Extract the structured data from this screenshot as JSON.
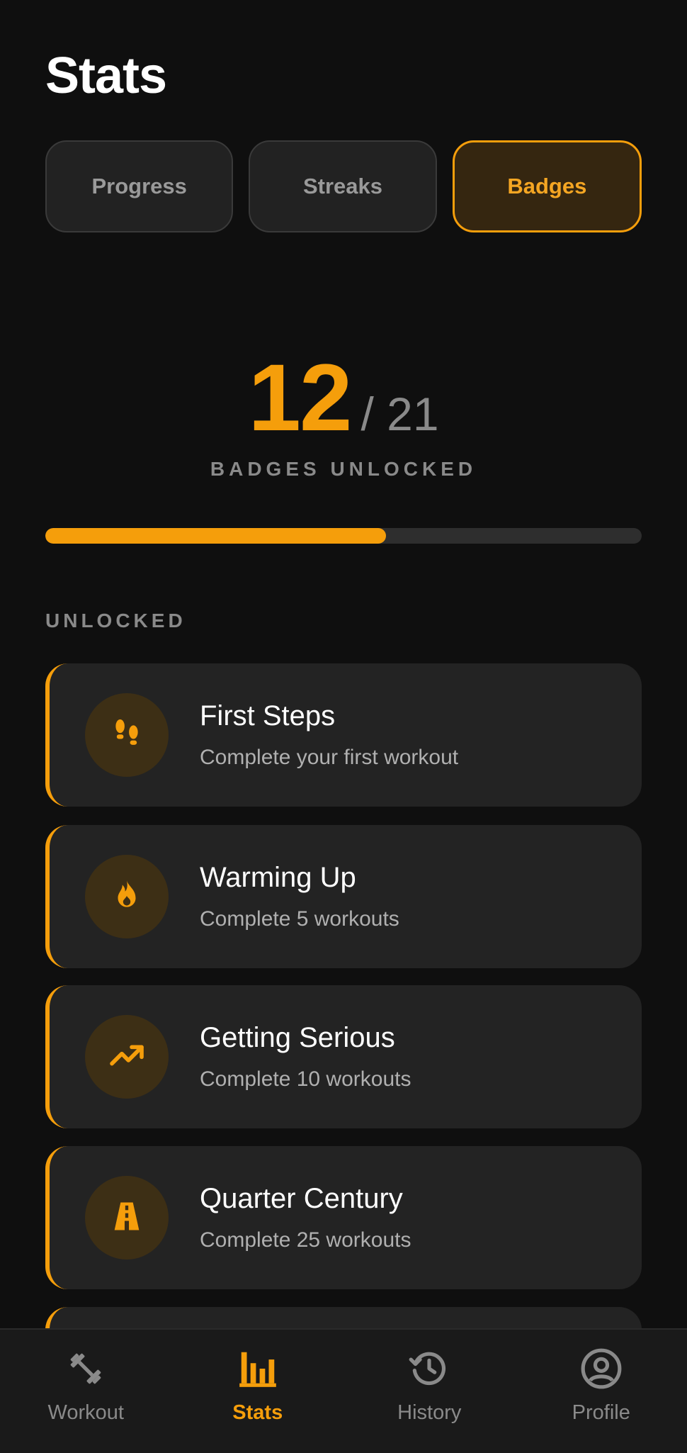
{
  "header": {
    "title": "Stats"
  },
  "tabs": [
    {
      "label": "Progress",
      "active": false
    },
    {
      "label": "Streaks",
      "active": false
    },
    {
      "label": "Badges",
      "active": true
    }
  ],
  "summary": {
    "unlocked": "12",
    "total": "/ 21",
    "caption": "BADGES UNLOCKED",
    "progress_fraction": 0.571
  },
  "section_title": "UNLOCKED",
  "badges": [
    {
      "name": "First Steps",
      "desc": "Complete your first workout",
      "icon": "footprints-icon"
    },
    {
      "name": "Warming Up",
      "desc": "Complete 5 workouts",
      "icon": "flame-icon"
    },
    {
      "name": "Getting Serious",
      "desc": "Complete 10 workouts",
      "icon": "trending-up-icon"
    },
    {
      "name": "Quarter Century",
      "desc": "Complete 25 workouts",
      "icon": "road-icon"
    }
  ],
  "nav": [
    {
      "label": "Workout",
      "icon": "dumbbell-icon",
      "active": false
    },
    {
      "label": "Stats",
      "icon": "bar-chart-icon",
      "active": true
    },
    {
      "label": "History",
      "icon": "history-icon",
      "active": false
    },
    {
      "label": "Profile",
      "icon": "profile-icon",
      "active": false
    }
  ],
  "colors": {
    "accent": "#f59e0b",
    "background": "#0f0f0f",
    "card": "#232323"
  }
}
